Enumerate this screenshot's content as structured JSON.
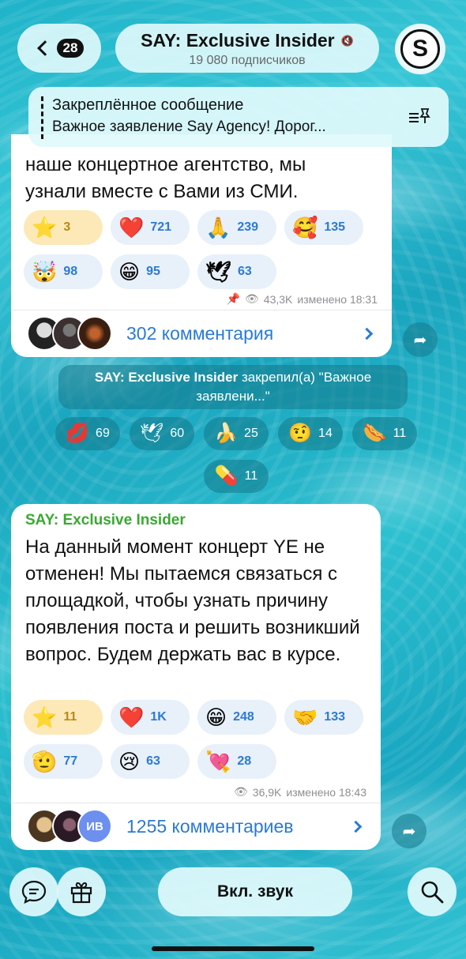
{
  "header": {
    "back_count": "28",
    "channel_title": "SAY: Exclusive Insider",
    "subscribers": "19 080 подписчиков",
    "avatar_letter": "S"
  },
  "pinned": {
    "title": "Закреплённое сообщение",
    "text": "Важное заявление Say Agency! Дорог..."
  },
  "message1": {
    "text_line1": "наше концертное агентство, мы",
    "text_line2": "узнали вместе с Вами из СМИ.",
    "reactions": [
      {
        "emoji": "⭐",
        "count": "3"
      },
      {
        "emoji": "❤️",
        "count": "721"
      },
      {
        "emoji": "🙏",
        "count": "239"
      },
      {
        "emoji": "🥰",
        "count": "135"
      },
      {
        "emoji": "🤯",
        "count": "98"
      },
      {
        "emoji": "😁",
        "count": "95"
      },
      {
        "emoji": "🕊",
        "count": "63"
      }
    ],
    "views": "43,3K",
    "edited": "изменено 18:31",
    "comments": "302 комментария"
  },
  "service": {
    "author": "SAY: Exclusive Insider",
    "action": "закрепил(а) \"Важное заявлени...\""
  },
  "service_reactions": [
    {
      "emoji": "💋",
      "count": "69"
    },
    {
      "emoji": "🕊",
      "count": "60"
    },
    {
      "emoji": "🍌",
      "count": "25"
    },
    {
      "emoji": "🤨",
      "count": "14"
    },
    {
      "emoji": "🌭",
      "count": "11"
    },
    {
      "emoji": "💊",
      "count": "11"
    }
  ],
  "message2": {
    "sender": "SAY: Exclusive Insider",
    "text": "На данный момент концерт YE не отменен! Мы пытаемся связаться с площадкой, чтобы узнать причину появления поста и решить возникший вопрос. Будем держать вас в курсе.",
    "reactions": [
      {
        "emoji": "⭐",
        "count": "11"
      },
      {
        "emoji": "❤️",
        "count": "1K"
      },
      {
        "emoji": "😁",
        "count": "248"
      },
      {
        "emoji": "🤝",
        "count": "133"
      },
      {
        "emoji": "🫡",
        "count": "77"
      },
      {
        "emoji": "😢",
        "count": "63"
      },
      {
        "emoji": "💘",
        "count": "28"
      }
    ],
    "views": "36,9K",
    "edited": "изменено 18:43",
    "comments": "1255 комментариев",
    "avatar_initials": "ИВ"
  },
  "bottom": {
    "sound_label": "Вкл. звук"
  },
  "colors": {
    "accent_blue": "#2a7ad6",
    "sender_green": "#3aa832",
    "star_bg": "#fde9b8"
  }
}
